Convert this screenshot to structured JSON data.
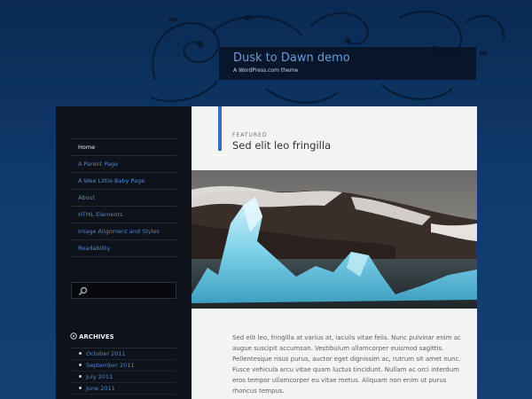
{
  "site": {
    "title": "Dusk to Dawn demo",
    "description": "A WordPress.com theme"
  },
  "sidebar": {
    "menu": [
      {
        "label": "Home"
      },
      {
        "label": "A Parent Page"
      },
      {
        "label": "A Wee Little Baby Page"
      },
      {
        "label": "About"
      },
      {
        "label": "HTML Elements"
      },
      {
        "label": "Image Alignment and Styles"
      },
      {
        "label": "Readability"
      }
    ],
    "search": {
      "placeholder": ""
    },
    "archives": {
      "title": "ARCHIVES",
      "items": [
        "October 2011",
        "September 2011",
        "July 2011",
        "June 2011"
      ]
    }
  },
  "post": {
    "label": "FEATURED",
    "title": "Sed elit leo fringilla",
    "excerpt": "Sed elit leo, fringilla at varius at, iaculis vitae felis. Nunc pulvinar enim ac augue suscipit accumsan. Vestibulum ullamcorper euismod sagittis. Pellentesque risus purus, auctor eget dignissim ac, rutrum sit amet nunc. Fusce vehicula arcu vitae quam luctus tincidunt. Nullam ac orci interdum eros tempor ullamcorper eu vitae metus. Aliquam non enim ut purus rhoncus tempus."
  },
  "colors": {
    "background": "#0f3a6c",
    "accent": "#3b6fb4",
    "link": "#4f87c8",
    "sidebar": "#0e121b",
    "content": "#f4f4f2"
  },
  "icons": {
    "search": "magnifier-icon",
    "archives": "archive-icon",
    "decoration": "floral-swirl"
  }
}
